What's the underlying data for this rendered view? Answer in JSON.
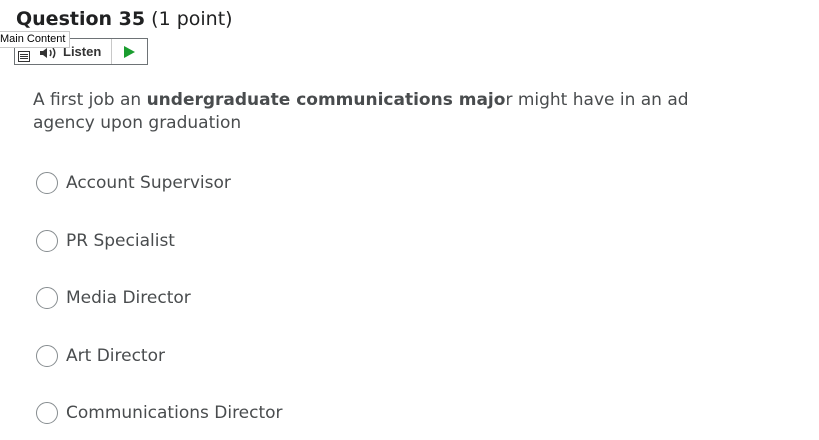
{
  "question": {
    "title": "Question 35",
    "points": "(1 point)",
    "text_parts": [
      {
        "text": "A first job an ",
        "bold": false
      },
      {
        "text": "undergraduate  communications majo",
        "bold": true
      },
      {
        "text": "r might have in an ad agency upon graduation",
        "bold": false
      }
    ]
  },
  "tooltip": {
    "main_content": "Main Content"
  },
  "listen_bar": {
    "label": "Listen",
    "icons": [
      "menu-icon",
      "speaker-icon",
      "play-icon"
    ],
    "play_color": "#1a9d2f"
  },
  "options": [
    {
      "label": "Account Supervisor",
      "selected": false
    },
    {
      "label": "PR Specialist",
      "selected": false
    },
    {
      "label": "Media Director",
      "selected": false
    },
    {
      "label": "Art Director",
      "selected": false
    },
    {
      "label": "Communications Director",
      "selected": false
    }
  ]
}
